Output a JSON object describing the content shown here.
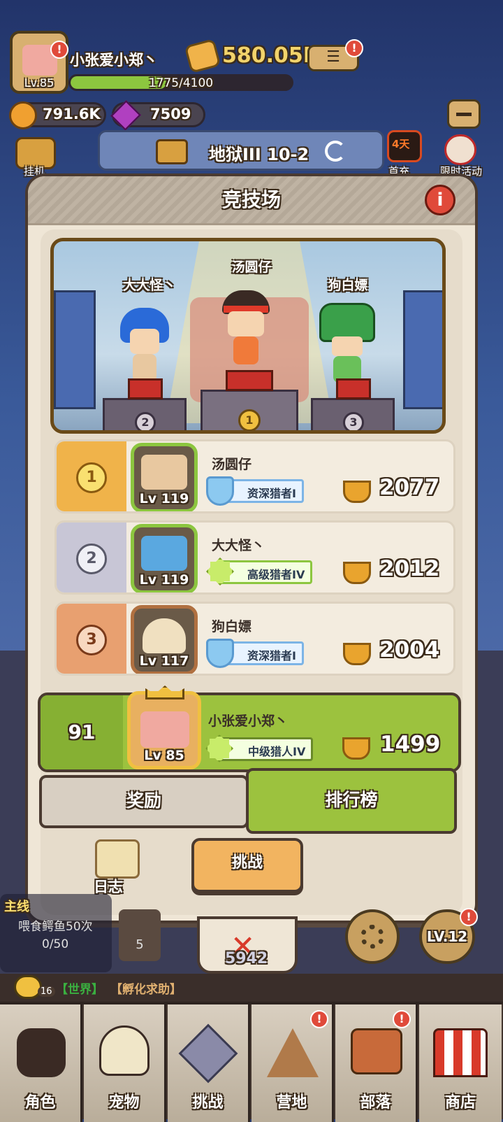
{
  "hud": {
    "player_name": "小张爱小郑丶",
    "level": "Lv.85",
    "xp": "1775/4100",
    "xp_fraction": 0.433,
    "gold": "580.05K",
    "coins": "791.6K",
    "gems": "7509"
  },
  "stage": {
    "label": "地狱III 10-2"
  },
  "left_menu": {
    "idle": "挂机"
  },
  "right_menu": {
    "first_recharge": "首充",
    "first_recharge_timer": "4天",
    "limited_event": "限时活动"
  },
  "arena": {
    "title": "竞技场",
    "podium": [
      {
        "name": "汤圆仔",
        "rank": "1"
      },
      {
        "name": "大大怪丶",
        "rank": "2"
      },
      {
        "name": "狗白嫖",
        "rank": "3"
      }
    ],
    "rows": [
      {
        "rank": "1",
        "name": "汤圆仔",
        "lv": "Lv 119",
        "title": "资深猎者I",
        "score": "2077"
      },
      {
        "rank": "2",
        "name": "大大怪丶",
        "lv": "Lv 119",
        "title": "高级猎者IV",
        "score": "2012"
      },
      {
        "rank": "3",
        "name": "狗白嫖",
        "lv": "Lv 117",
        "title": "资深猎者I",
        "score": "2004"
      }
    ],
    "me": {
      "rank": "91",
      "name": "小张爱小郑丶",
      "lv": "Lv 85",
      "title": "中级猎人IV",
      "score": "1499"
    },
    "tab_reward": "奖励",
    "tab_ranking": "排行榜",
    "log": "日志",
    "challenge": "挑战"
  },
  "quest": {
    "label": "主线",
    "task": "喂食鳄鱼50次",
    "progress": "0/50",
    "count": "5",
    "power": "5942",
    "level": "LV.12"
  },
  "chat": {
    "count": "16",
    "world": "【世界】",
    "incubate": "【孵化求助】"
  },
  "tabs": [
    "角色",
    "宠物",
    "挑战",
    "营地",
    "部落",
    "商店"
  ],
  "colors": {
    "green": "#8cc63f",
    "gold": "#f0b34a",
    "brown": "#4a3a30",
    "red": "#e04a3a"
  }
}
